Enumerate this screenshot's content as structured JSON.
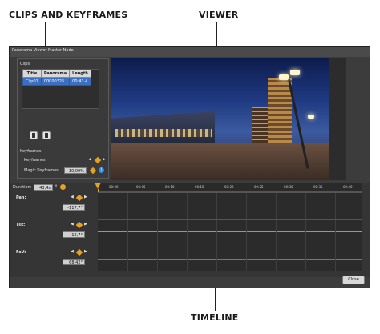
{
  "annotations": {
    "clips_keyframes": "CLIPS AND KEYFRAMES",
    "viewer": "VIEWER",
    "timeline": "TIMELINE"
  },
  "menubar": {
    "items": [
      "Panorama Viewer",
      "Master Node"
    ]
  },
  "clips_panel": {
    "title": "Clips",
    "columns": [
      "Title",
      "Panorama",
      "Length"
    ],
    "rows": [
      {
        "title": "Clip01",
        "panorama": "00000325",
        "length": "00:43.4"
      }
    ]
  },
  "keyframes_panel": {
    "title": "Keyframes",
    "keyframes_label": "Keyframes:",
    "magic_label": "Magic Keyframes:",
    "magic_value": "10,00%"
  },
  "timeline": {
    "duration_label": "Duration:",
    "duration_value": "43,4s",
    "ticks": [
      "00:00",
      "00:05",
      "00:10",
      "00:15",
      "00:20",
      "00:25",
      "00:30",
      "00:35",
      "00:40"
    ],
    "tracks": [
      {
        "label": "Pan:",
        "value": "-117,7°"
      },
      {
        "label": "Tilt:",
        "value": "12,7°"
      },
      {
        "label": "FoV:",
        "value": "68,42°"
      }
    ]
  },
  "close_label": "Close",
  "colors": {
    "selection": "#3a6fc2",
    "keyframe": "#e8a020",
    "pan_curve": "#d05a5a",
    "tilt_curve": "#5ac05a",
    "fov_curve": "#6a6ad8"
  }
}
